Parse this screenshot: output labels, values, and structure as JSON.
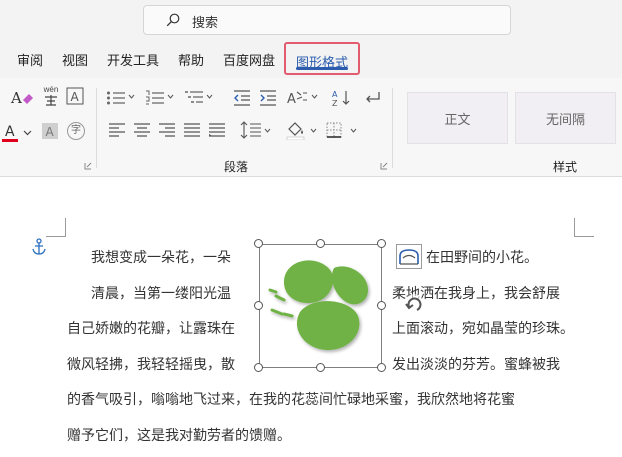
{
  "search": {
    "placeholder": "搜索"
  },
  "tabs": [
    {
      "label": "审阅"
    },
    {
      "label": "视图"
    },
    {
      "label": "开发工具"
    },
    {
      "label": "帮助"
    },
    {
      "label": "百度网盘"
    },
    {
      "label": "图形格式",
      "active": true
    }
  ],
  "ribbon": {
    "groups": [
      {
        "label": "段落"
      },
      {
        "label": "样式"
      }
    ],
    "font_buttons": {
      "phonetic": "wén",
      "char_circle": "字"
    },
    "styles": [
      {
        "label": "正文"
      },
      {
        "label": "无间隔"
      }
    ]
  },
  "colors": {
    "accent": "#2b5cae",
    "tab_highlight": "#e25b6e",
    "shape_green": "#6fb244",
    "font_color_bar": "#e0001b"
  },
  "document": {
    "lines": [
      {
        "left": "我想变成一朵花，一朵",
        "right": "在田野间的小花。"
      },
      {
        "left": "清晨，当第一缕阳光温",
        "right": "柔地洒在我身上，我会舒展"
      },
      {
        "left": "自己娇嫩的花瓣，让露珠在",
        "right": "上面滚动，宛如晶莹的珍珠。"
      },
      {
        "left": "微风轻拂，我轻轻摇曳，散",
        "right": "发出淡淡的芬芳。蜜蜂被我"
      },
      {
        "left": "的香气吸引，嗡嗡地飞过来，在我的花蕊间忙碌地采蜜，我欣然地将花蜜"
      },
      {
        "left": "赠予它们，这是我对勤劳者的馈赠。"
      }
    ]
  },
  "icons": {
    "search": "search-icon",
    "anchor": "anchor-icon",
    "layout_options": "layout-options-icon",
    "rotate": "rotate-handle-icon",
    "shape": "leaf-shape"
  }
}
